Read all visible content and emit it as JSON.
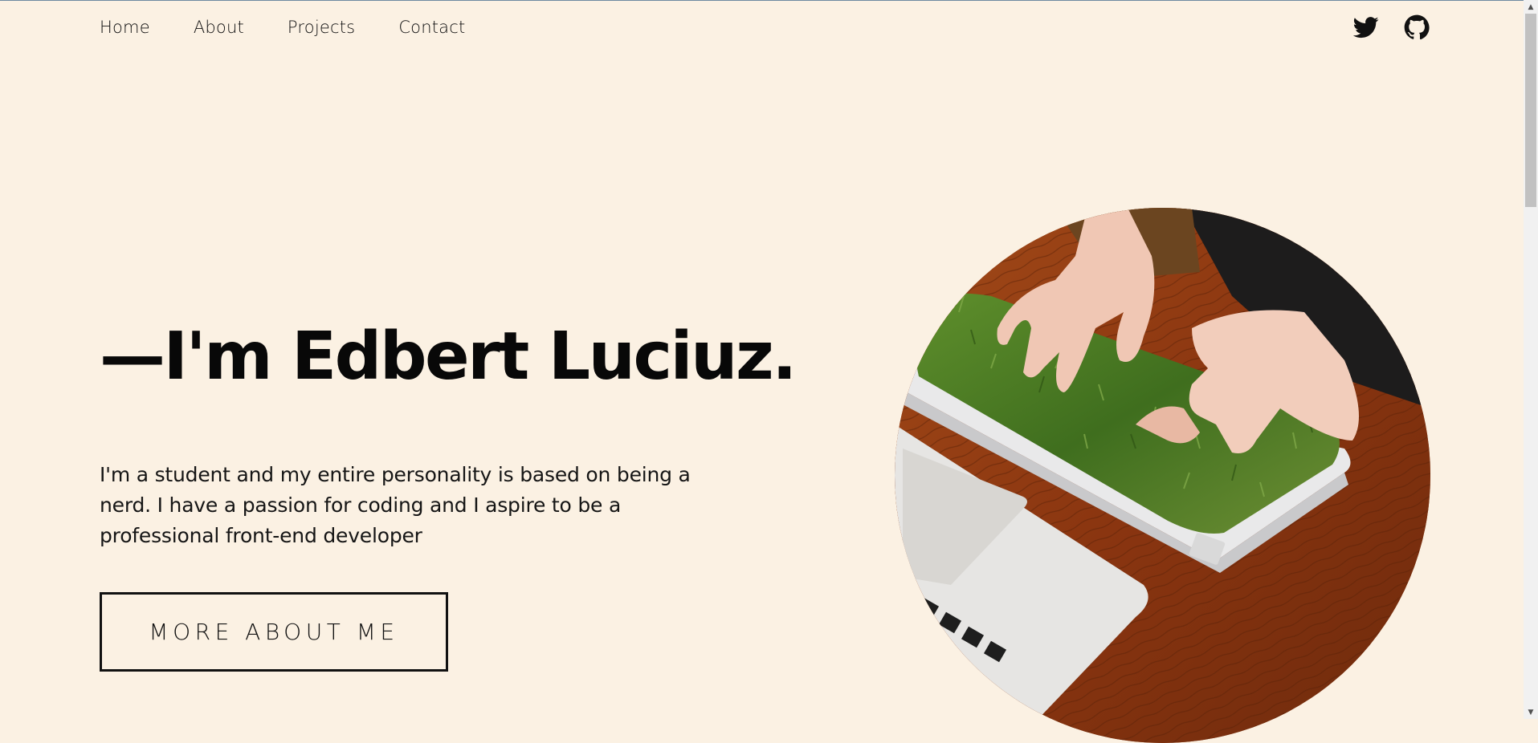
{
  "nav": {
    "items": [
      {
        "label": "Home"
      },
      {
        "label": "About"
      },
      {
        "label": "Projects"
      },
      {
        "label": "Contact"
      }
    ]
  },
  "social": {
    "twitter_icon": "twitter-icon",
    "github_icon": "github-icon"
  },
  "hero": {
    "title": "—I'm Edbert Luciuz.",
    "description": "I'm a student and my entire personality is based on being a nerd. I have a passion for coding and I aspire to be a professional front-end developer",
    "button_label": "MORE ABOUT ME"
  },
  "colors": {
    "background": "#fbf1e3",
    "text": "#0d0d0d"
  }
}
